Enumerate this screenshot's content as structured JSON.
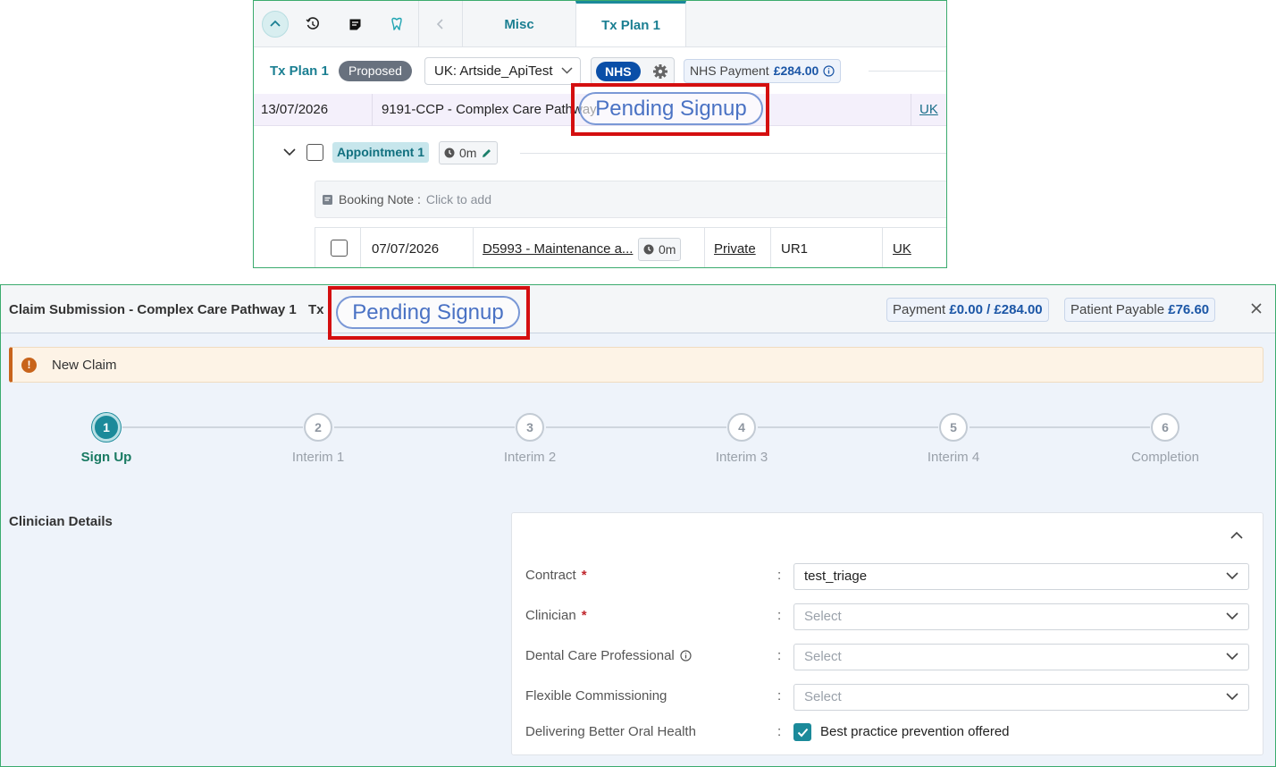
{
  "top": {
    "tabs": [
      {
        "label": "Misc"
      },
      {
        "label": "Tx Plan 1"
      }
    ],
    "plan": {
      "label": "Tx Plan 1",
      "status": "Proposed",
      "location": "UK: Artside_ApiTest",
      "nhs_label": "NHS",
      "nhs_payment_label": "NHS Payment",
      "nhs_payment_value": "£284.00"
    },
    "course": {
      "date": "13/07/2026",
      "description": "9191-CCP - Complex Care Pathway",
      "link": "UK"
    },
    "pending_overlay": "Pending Signup",
    "appointment": {
      "label": "Appointment 1",
      "time": "0m"
    },
    "booking": {
      "label": "Booking Note :",
      "placeholder": "Click to add"
    },
    "item": {
      "date": "07/07/2026",
      "description": "D5993 - Maintenance a...",
      "time": "0m",
      "type": "Private",
      "tooth": "UR1",
      "link": "UK"
    }
  },
  "claim": {
    "title": "Claim Submission - Complex Care Pathway 1",
    "tx_label": "Tx",
    "pending_overlay": "Pending Signup",
    "payment_label": "Payment",
    "payment_value": "£0.00 / £284.00",
    "patient_payable_label": "Patient Payable",
    "patient_payable_value": "£76.60",
    "alert": "New Claim",
    "steps": [
      {
        "number": "1",
        "label": "Sign Up",
        "active": true
      },
      {
        "number": "2",
        "label": "Interim 1",
        "active": false
      },
      {
        "number": "3",
        "label": "Interim 2",
        "active": false
      },
      {
        "number": "4",
        "label": "Interim 3",
        "active": false
      },
      {
        "number": "5",
        "label": "Interim 4",
        "active": false
      },
      {
        "number": "6",
        "label": "Completion",
        "active": false
      }
    ],
    "section_title": "Clinician Details",
    "form": {
      "contract": {
        "label": "Contract",
        "value": "test_triage"
      },
      "clinician": {
        "label": "Clinician",
        "value": "Select"
      },
      "dcp": {
        "label": "Dental Care Professional",
        "value": "Select"
      },
      "flex": {
        "label": "Flexible Commissioning",
        "value": "Select"
      },
      "dbo": {
        "label": "Delivering Better Oral Health",
        "checkbox_label": "Best practice prevention offered",
        "checked": true
      },
      "colon": ":",
      "required_mark": "*"
    }
  },
  "colors": {
    "accent": "#1b8a9a",
    "highlight_red": "#d40f10",
    "nhs_blue": "#0a4fa8",
    "warning": "#c8641b"
  }
}
